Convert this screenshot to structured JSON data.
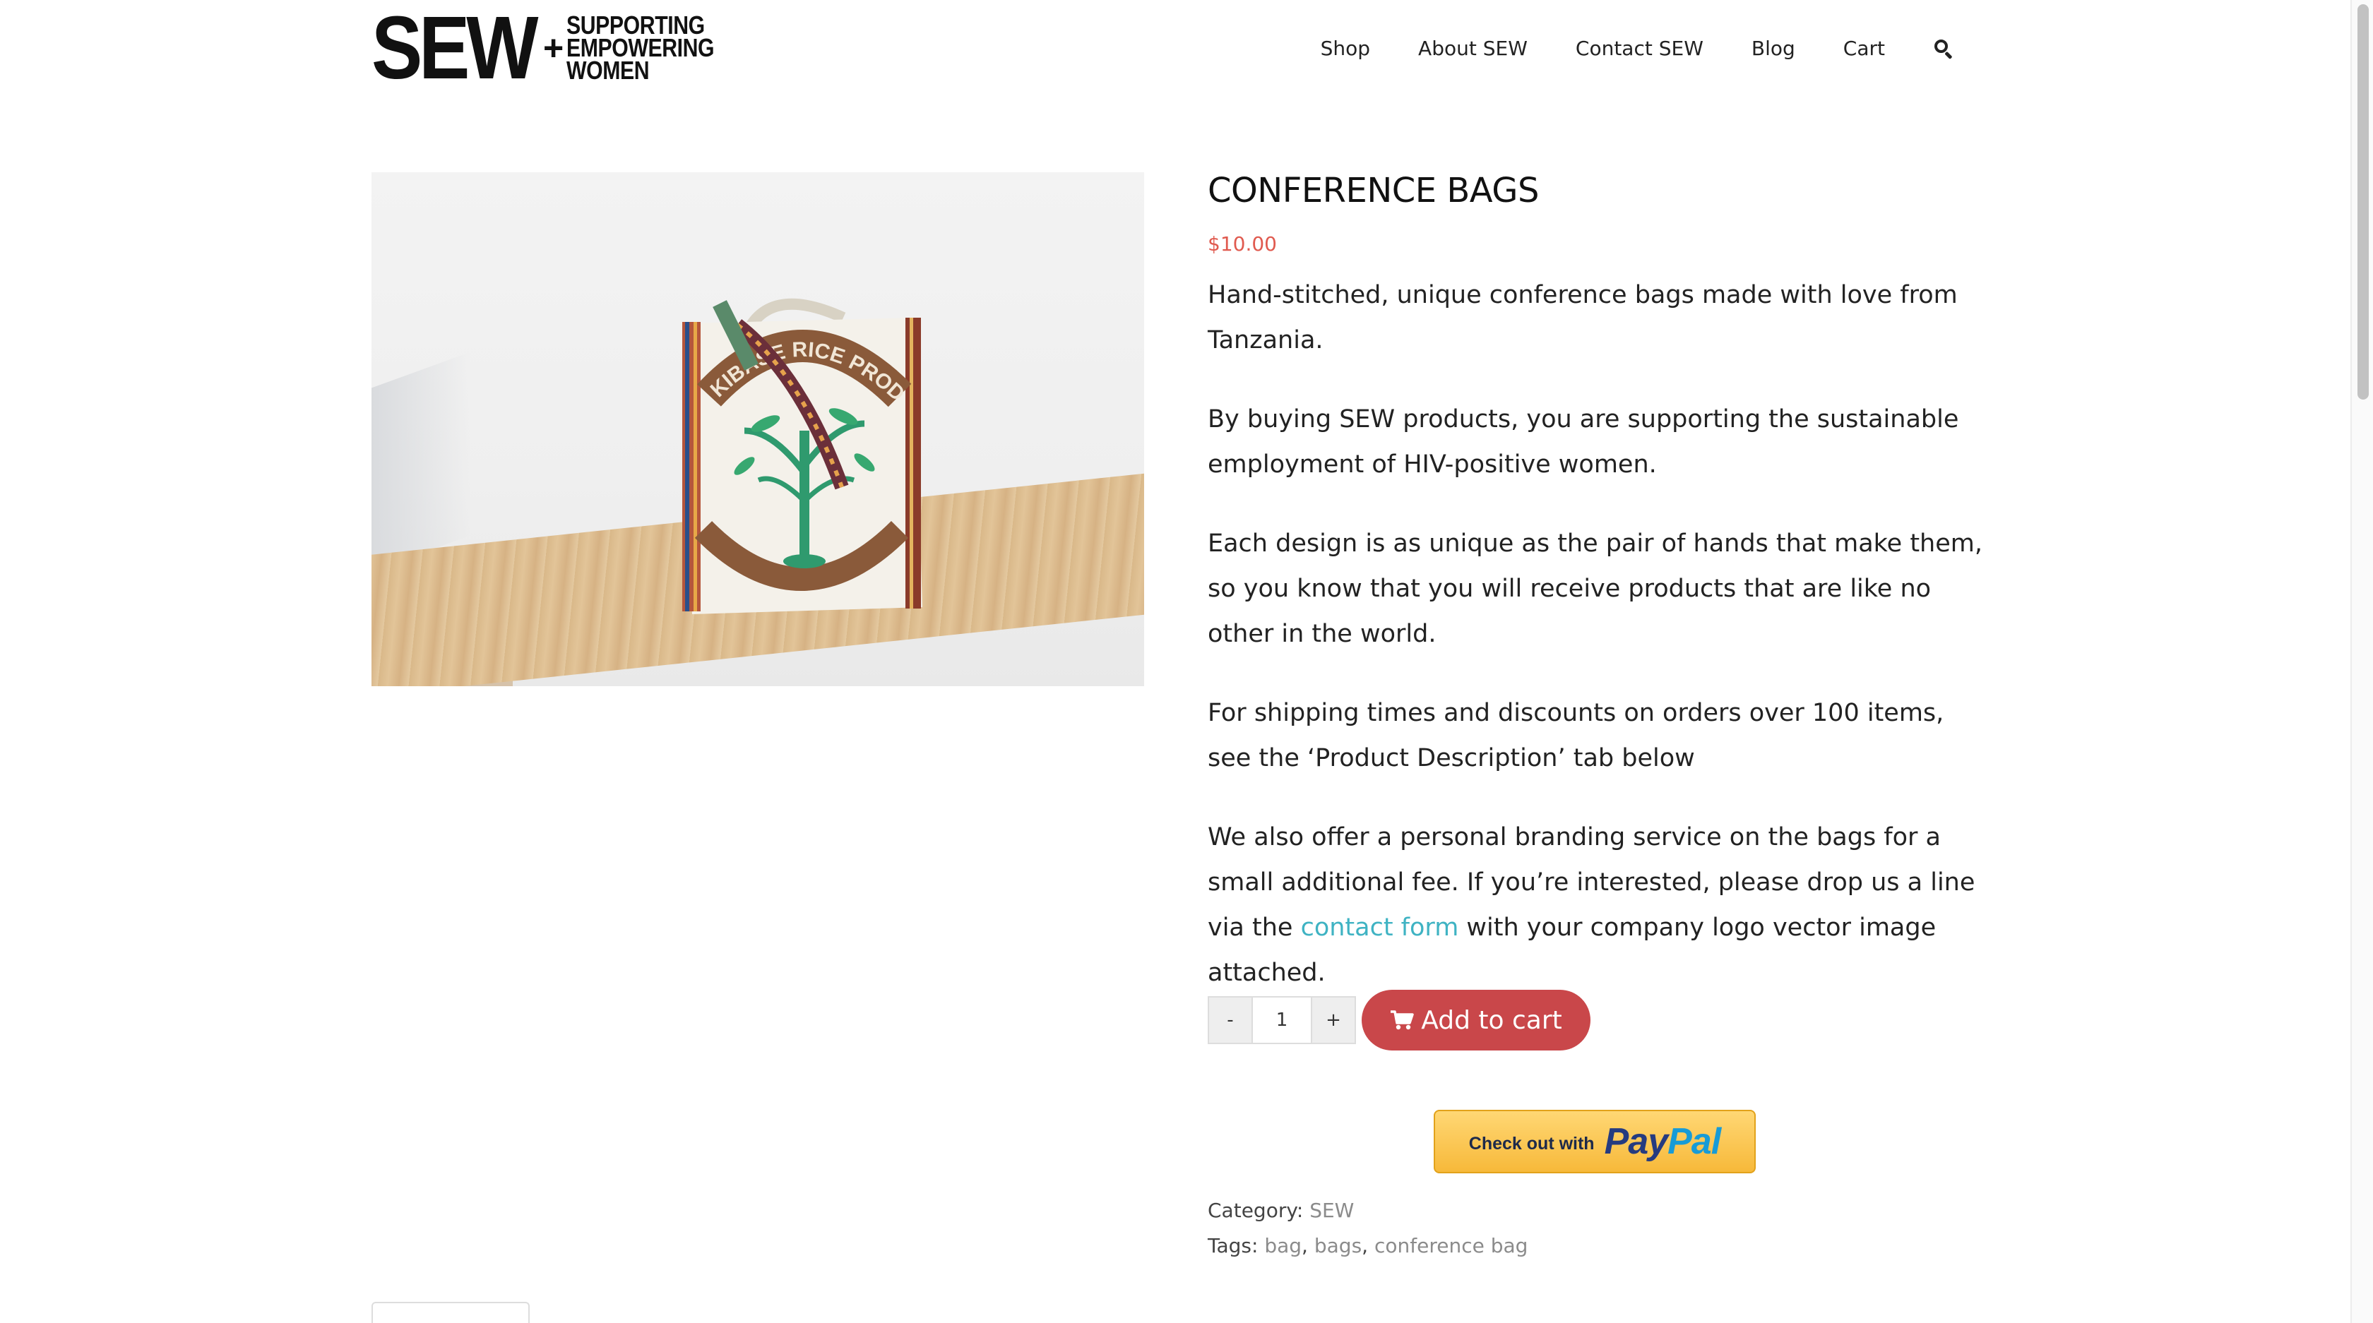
{
  "brand": {
    "logo_main": "SEW",
    "logo_plus": "+",
    "logo_line1": "SUPPORTING",
    "logo_line2": "EMPOWERING",
    "logo_line3": "WOMEN"
  },
  "nav": {
    "items": [
      "Shop",
      "About SEW",
      "Contact SEW",
      "Blog",
      "Cart"
    ],
    "search_icon": "search-icon"
  },
  "product": {
    "title": "CONFERENCE BAGS",
    "price": "$10.00",
    "image_print_text": "KIBASE RICE PRODUCTS",
    "description": [
      "Hand-stitched, unique conference bags made with love from Tanzania.",
      "By buying SEW products, you are supporting the sustainable employment of HIV-positive women.",
      "Each design is as unique as the pair of hands that make them, so you know that you will receive products that are like no other in the world.",
      "For shipping times and discounts on orders over 100 items, see the ‘Product Description’ tab below"
    ],
    "branding_before": "We also offer a personal branding service on the bags for a small additional fee. If you’re interested, please drop us a line via the ",
    "branding_link": "contact form",
    "branding_after": " with your company logo vector image attached."
  },
  "cart": {
    "minus": "-",
    "quantity": "1",
    "plus": "+",
    "add_label": "Add to cart",
    "cart_icon": "shopping-cart-icon"
  },
  "paypal": {
    "prefix": "Check out with",
    "pay": "Pay",
    "pal": "Pal"
  },
  "meta": {
    "category_label": "Category:",
    "category_value": "SEW",
    "tags_label": "Tags:",
    "tag1": "bag",
    "tag2": "bags",
    "tag3": "conference bag",
    "separator": ","
  },
  "colors": {
    "price": "#e05a4f",
    "link": "#3fb3c3",
    "cart_button": "#c9474a",
    "paypal_blue_dark": "#253b80",
    "paypal_blue_light": "#179bd7"
  }
}
